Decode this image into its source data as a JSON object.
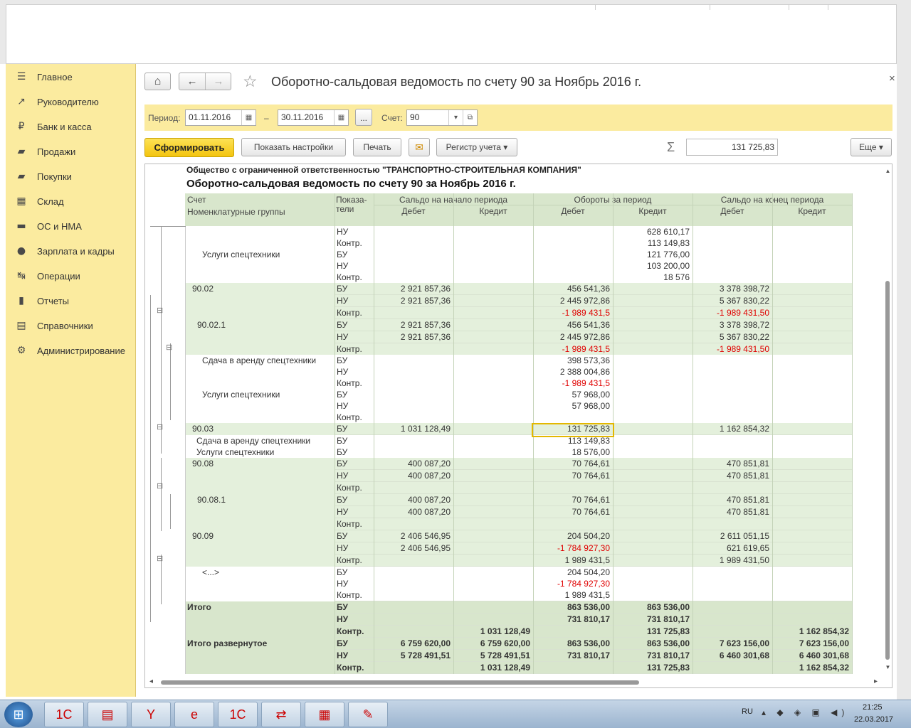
{
  "sidebar": {
    "items": [
      {
        "label": "Главное",
        "icon": "menu-icon",
        "glyph": "☰"
      },
      {
        "label": "Руководителю",
        "icon": "trend-icon",
        "glyph": "↗"
      },
      {
        "label": "Банк и касса",
        "icon": "ruble-icon",
        "glyph": "₽"
      },
      {
        "label": "Продажи",
        "icon": "bag-icon",
        "glyph": "▰"
      },
      {
        "label": "Покупки",
        "icon": "cart-icon",
        "glyph": "▰"
      },
      {
        "label": "Склад",
        "icon": "grid-icon",
        "glyph": "▦"
      },
      {
        "label": "ОС и НМА",
        "icon": "truck-icon",
        "glyph": "▬"
      },
      {
        "label": "Зарплата и кадры",
        "icon": "person-icon",
        "glyph": "●"
      },
      {
        "label": "Операции",
        "icon": "operations-icon",
        "glyph": "↹"
      },
      {
        "label": "Отчеты",
        "icon": "barchart-icon",
        "glyph": "▮"
      },
      {
        "label": "Справочники",
        "icon": "book-icon",
        "glyph": "▤"
      },
      {
        "label": "Администрирование",
        "icon": "gear-icon",
        "glyph": "⚙"
      }
    ]
  },
  "header": {
    "title": "Оборотно-сальдовая ведомость по счету 90 за Ноябрь 2016 г.",
    "home_glyph": "⌂",
    "back_glyph": "←",
    "forward_glyph": "→",
    "star_glyph": "☆",
    "close_glyph": "×"
  },
  "params": {
    "period_label": "Период:",
    "date_from": "01.11.2016",
    "dash": "–",
    "date_to": "30.11.2016",
    "dots": "...",
    "account_label": "Счет:",
    "account_value": "90",
    "cal_glyph": "▦",
    "dropdown_glyph": "▾",
    "open_glyph": "⧉"
  },
  "toolbar": {
    "generate": "Сформировать",
    "show_settings": "Показать настройки",
    "print": "Печать",
    "mail_glyph": "✉",
    "register": "Регистр учета ▾",
    "sigma": "Σ",
    "sum_value": "131 725,83",
    "more": "Еще ▾"
  },
  "report": {
    "org": "Общество с ограниченной ответственностью \"ТРАНСПОРТНО-СТРОИТЕЛЬНАЯ КОМПАНИЯ\"",
    "title": "Оборотно-сальдовая ведомость по счету 90 за Ноябрь 2016 г.",
    "headers": {
      "account": "Счет",
      "groups": "Номенклатурные группы",
      "indicators_1": "Показа-",
      "indicators_2": "тели",
      "opening": "Сальдо на начало периода",
      "turnover": "Обороты за период",
      "closing": "Сальдо на конец периода",
      "debit": "Дебет",
      "credit": "Кредит"
    },
    "rows": [
      [
        "",
        "НУ",
        "",
        "",
        "",
        "628 610,17",
        "",
        ""
      ],
      [
        "",
        "Контр.",
        "",
        "",
        "",
        "113 149,83",
        "",
        ""
      ],
      [
        "Услуги спецтехники",
        "БУ",
        "",
        "",
        "",
        "121 776,00",
        "",
        ""
      ],
      [
        "",
        "НУ",
        "",
        "",
        "",
        "103 200,00",
        "",
        ""
      ],
      [
        "",
        "Контр.",
        "",
        "",
        "",
        "18 576",
        "",
        ""
      ],
      [
        "90.02",
        "БУ",
        "2 921 857,36",
        "",
        "456 541,36",
        "",
        "3 378 398,72",
        ""
      ],
      [
        "",
        "НУ",
        "2 921 857,36",
        "",
        "2 445 972,86",
        "",
        "5 367 830,22",
        ""
      ],
      [
        "",
        "Контр.",
        "",
        "",
        "-1 989 431,5",
        "",
        "-1 989 431,50",
        ""
      ],
      [
        "90.02.1",
        "БУ",
        "2 921 857,36",
        "",
        "456 541,36",
        "",
        "3 378 398,72",
        ""
      ],
      [
        "",
        "НУ",
        "2 921 857,36",
        "",
        "2 445 972,86",
        "",
        "5 367 830,22",
        ""
      ],
      [
        "",
        "Контр.",
        "",
        "",
        "-1 989 431,5",
        "",
        "-1 989 431,50",
        ""
      ],
      [
        "Сдача в аренду спецтехники",
        "БУ",
        "",
        "",
        "398 573,36",
        "",
        "",
        ""
      ],
      [
        "",
        "НУ",
        "",
        "",
        "2 388 004,86",
        "",
        "",
        ""
      ],
      [
        "",
        "Контр.",
        "",
        "",
        "-1 989 431,5",
        "",
        "",
        ""
      ],
      [
        "Услуги спецтехники",
        "БУ",
        "",
        "",
        "57 968,00",
        "",
        "",
        ""
      ],
      [
        "",
        "НУ",
        "",
        "",
        "57 968,00",
        "",
        "",
        ""
      ],
      [
        "",
        "Контр.",
        "",
        "",
        "",
        "",
        "",
        ""
      ],
      [
        "90.03",
        "БУ",
        "1 031 128,49",
        "",
        "131 725,83",
        "",
        "1 162 854,32",
        ""
      ],
      [
        "Сдача в аренду спецтехники",
        "БУ",
        "",
        "",
        "113 149,83",
        "",
        "",
        ""
      ],
      [
        "Услуги спецтехники",
        "БУ",
        "",
        "",
        "18 576,00",
        "",
        "",
        ""
      ],
      [
        "90.08",
        "БУ",
        "400 087,20",
        "",
        "70 764,61",
        "",
        "470 851,81",
        ""
      ],
      [
        "",
        "НУ",
        "400 087,20",
        "",
        "70 764,61",
        "",
        "470 851,81",
        ""
      ],
      [
        "",
        "Контр.",
        "",
        "",
        "",
        "",
        "",
        ""
      ],
      [
        "90.08.1",
        "БУ",
        "400 087,20",
        "",
        "70 764,61",
        "",
        "470 851,81",
        ""
      ],
      [
        "",
        "НУ",
        "400 087,20",
        "",
        "70 764,61",
        "",
        "470 851,81",
        ""
      ],
      [
        "",
        "Контр.",
        "",
        "",
        "",
        "",
        "",
        ""
      ],
      [
        "90.09",
        "БУ",
        "2 406 546,95",
        "",
        "204 504,20",
        "",
        "2 611 051,15",
        ""
      ],
      [
        "",
        "НУ",
        "2 406 546,95",
        "",
        "-1 784 927,30",
        "",
        "621 619,65",
        ""
      ],
      [
        "",
        "Контр.",
        "",
        "",
        "1 989 431,5",
        "",
        "1 989 431,50",
        ""
      ],
      [
        "<...>",
        "БУ",
        "",
        "",
        "204 504,20",
        "",
        "",
        ""
      ],
      [
        "",
        "НУ",
        "",
        "",
        "-1 784 927,30",
        "",
        "",
        ""
      ],
      [
        "",
        "Контр.",
        "",
        "",
        "1 989 431,5",
        "",
        "",
        ""
      ],
      [
        "Итого",
        "БУ",
        "",
        "",
        "863 536,00",
        "863 536,00",
        "",
        ""
      ],
      [
        "",
        "НУ",
        "",
        "",
        "731 810,17",
        "731 810,17",
        "",
        ""
      ],
      [
        "",
        "Контр.",
        "",
        "1 031 128,49",
        "",
        "131 725,83",
        "",
        "1 162 854,32"
      ],
      [
        "Итого развернутое",
        "БУ",
        "6 759 620,00",
        "6 759 620,00",
        "863 536,00",
        "863 536,00",
        "7 623 156,00",
        "7 623 156,00"
      ],
      [
        "",
        "НУ",
        "5 728 491,51",
        "5 728 491,51",
        "731 810,17",
        "731 810,17",
        "6 460 301,68",
        "6 460 301,68"
      ],
      [
        "",
        "Контр.",
        "",
        "1 031 128,49",
        "",
        "131 725,83",
        "",
        "1 162 854,32"
      ]
    ],
    "collapse_glyph": "⊟",
    "scroll_up": "▲",
    "scroll_down": "▼",
    "scroll_left": "◂",
    "scroll_right": "▸"
  },
  "taskbar": {
    "start_glyph": "⊞",
    "apps": [
      {
        "name": "1c-app-icon",
        "glyph": "1С"
      },
      {
        "name": "explorer-icon",
        "glyph": "▤"
      },
      {
        "name": "yandex-browser-icon",
        "glyph": "Y"
      },
      {
        "name": "ie-icon",
        "glyph": "e"
      },
      {
        "name": "1c-enterprise-icon",
        "glyph": "1С"
      },
      {
        "name": "teamviewer-icon",
        "glyph": "⇄"
      },
      {
        "name": "calculator-icon",
        "glyph": "▦"
      },
      {
        "name": "paint-icon",
        "glyph": "✎"
      }
    ],
    "lang": "RU",
    "tray": "▴ ◆ ◈ ▣ ◀)",
    "time": "21:25",
    "date": "22.03.2017"
  },
  "colors": {
    "accent_yellow": "#fbeb9f",
    "generate_button": "#f5cb1a",
    "group_row_bg": "#e4f0dc",
    "header_bg": "#d8e6cc",
    "negative": "#e00000",
    "selected_cell_border": "#e3b800"
  }
}
